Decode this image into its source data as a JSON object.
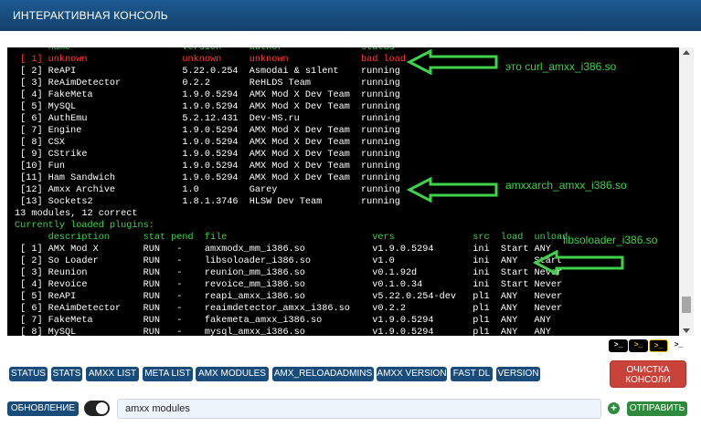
{
  "header": {
    "title": "ИНТЕРАКТИВНАЯ КОНСОЛЬ"
  },
  "console": {
    "lines": [
      {
        "text": "      name                    version     author              status",
        "color": "green"
      },
      {
        "text": " [ 1] unknown                 unknown     unknown             bad load",
        "color": "red"
      },
      {
        "text": " [ 2] ReAPI                   5.22.0.254  Asmodai & s1lent    running",
        "color": "white"
      },
      {
        "text": " [ 3] ReAimDetector           0.2.2       ReHLDS Team         running",
        "color": "white"
      },
      {
        "text": " [ 4] FakeMeta                1.9.0.5294  AMX Mod X Dev Team  running",
        "color": "white"
      },
      {
        "text": " [ 5] MySQL                   1.9.0.5294  AMX Mod X Dev Team  running",
        "color": "white"
      },
      {
        "text": " [ 6] AuthEmu                 5.2.12.431  Dev-MS.ru           running",
        "color": "white"
      },
      {
        "text": " [ 7] Engine                  1.9.0.5294  AMX Mod X Dev Team  running",
        "color": "white"
      },
      {
        "text": " [ 8] CSX                     1.9.0.5294  AMX Mod X Dev Team  running",
        "color": "white"
      },
      {
        "text": " [ 9] CStrike                 1.9.0.5294  AMX Mod X Dev Team  running",
        "color": "white"
      },
      {
        "text": " [10] Fun                     1.9.0.5294  AMX Mod X Dev Team  running",
        "color": "white"
      },
      {
        "text": " [11] Ham Sandwich            1.9.0.5294  AMX Mod X Dev Team  running",
        "color": "white"
      },
      {
        "text": " [12] Amxx Archive            1.0         Garey               running",
        "color": "white"
      },
      {
        "text": " [13] Sockets2                1.8.1.3746  HLSW Dev Team       running",
        "color": "white"
      },
      {
        "text": "13 modules, 12 correct",
        "color": "white"
      },
      {
        "text": "Currently loaded plugins:",
        "color": "green"
      },
      {
        "text": "      description      stat pend  file                          vers              src  load  unload",
        "color": "green"
      },
      {
        "text": " [ 1] AMX Mod X        RUN   -    amxmodx_mm_i386.so            v1.9.0.5294       ini  Start ANY",
        "color": "white"
      },
      {
        "text": " [ 2] So Loader        RUN   -    libsoloader_i386.so           v1.0              ini  ANY   Start",
        "color": "white"
      },
      {
        "text": " [ 3] Reunion          RUN   -    reunion_mm_i386.so            v0.1.92d          ini  Start Never",
        "color": "white"
      },
      {
        "text": " [ 4] Revoice          RUN   -    revoice_mm_i386.so            v0.1.0.34         ini  Start Never",
        "color": "white"
      },
      {
        "text": " [ 5] ReAPI            RUN   -    reapi_amxx_i386.so            v5.22.0.254-dev   pl1  ANY   Never",
        "color": "white"
      },
      {
        "text": " [ 6] ReAimDetector    RUN   -    reaimdetector_amxx_i386.so    v0.2.2            pl1  ANY   Never",
        "color": "white"
      },
      {
        "text": " [ 7] FakeMeta         RUN   -    fakemeta_amxx_i386.so         v1.9.0.5294       pl1  ANY   ANY",
        "color": "white"
      },
      {
        "text": " [ 8] MySQL            RUN   -    mysql_amxx_i386.so            v1.9.0.5294       pl1  ANY   ANY",
        "color": "white"
      }
    ],
    "annotations": [
      {
        "label": "это curl_amxx_i386.so"
      },
      {
        "label": "amxxarch_amxx_i386.so"
      },
      {
        "label": "libsoloader_i386.so"
      }
    ]
  },
  "theme_icons": [
    {
      "name": "terminal-dark-icon",
      "glyph": ">_"
    },
    {
      "name": "terminal-yellow-icon",
      "glyph": ">_"
    },
    {
      "name": "terminal-contrast-icon",
      "glyph": ">_"
    },
    {
      "name": "terminal-light-icon",
      "glyph": ">_"
    }
  ],
  "buttons": [
    {
      "name": "status-button",
      "label": "STATUS"
    },
    {
      "name": "stats-button",
      "label": "STATS"
    },
    {
      "name": "amxx-list-button",
      "label": "AMXX LIST"
    },
    {
      "name": "meta-list-button",
      "label": "META LIST"
    },
    {
      "name": "amx-modules-button",
      "label": "AMX MODULES"
    },
    {
      "name": "amx-reloadadmins-button",
      "label": "AMX_RELOADADMINS"
    },
    {
      "name": "amxx-version-button",
      "label": "AMXX VERSION"
    },
    {
      "name": "fast-dl-button",
      "label": "FAST DL"
    },
    {
      "name": "version-button",
      "label": "VERSION"
    }
  ],
  "clear_button": {
    "line1": "ОЧИСТКА",
    "line2": "КОНСОЛИ"
  },
  "refresh_button": {
    "label": "ОБНОВЛЕНИЕ"
  },
  "command_input": {
    "value": "amxx modules"
  },
  "send_button": {
    "label": "ОТПРАВИТЬ"
  },
  "colors": {
    "accent": "#1a4c7b",
    "danger": "#c94239",
    "success": "#2e8b3e",
    "console_green": "#3fd24a",
    "console_red": "#ff3b3b"
  }
}
